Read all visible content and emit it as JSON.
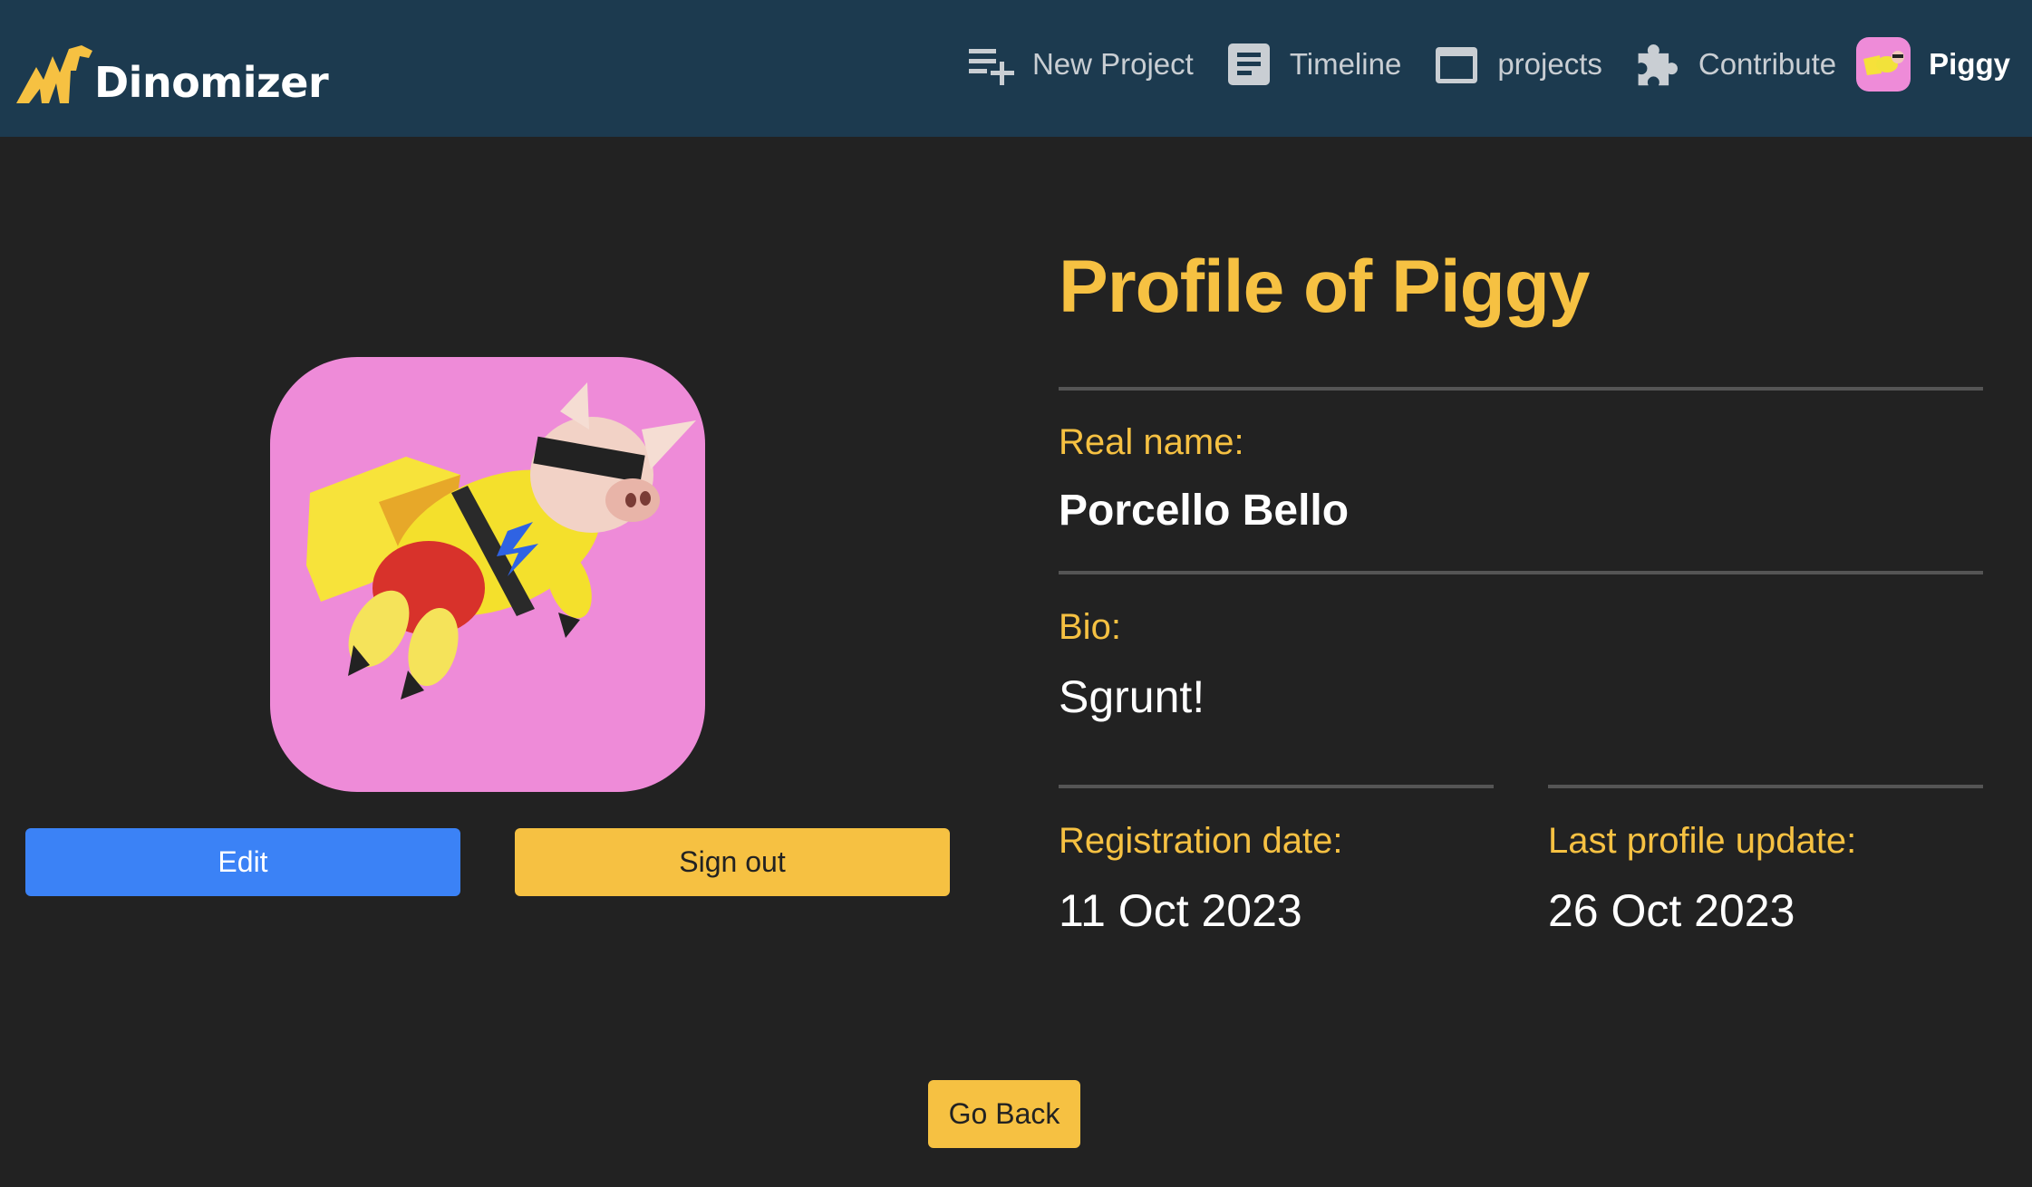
{
  "header": {
    "brand": "Dinomizer",
    "nav": [
      {
        "label": "New Project",
        "icon": "playlist-add-icon"
      },
      {
        "label": "Timeline",
        "icon": "timeline-doc-icon"
      },
      {
        "label": "projects",
        "icon": "window-icon"
      },
      {
        "label": "Contribute",
        "icon": "puzzle-icon"
      }
    ],
    "user": "Piggy"
  },
  "profile": {
    "title": "Profile of Piggy",
    "real_name_label": "Real name:",
    "real_name": "Porcello Bello",
    "bio_label": "Bio:",
    "bio": "Sgrunt!",
    "registration_label": "Registration date:",
    "registration_date": "11 Oct 2023",
    "last_update_label": "Last profile update:",
    "last_update": "26 Oct 2023"
  },
  "actions": {
    "edit": "Edit",
    "sign_out": "Sign out",
    "go_back": "Go Back"
  },
  "colors": {
    "header_bg": "#1c3a4f",
    "page_bg": "#222222",
    "accent": "#f6c142",
    "primary": "#3b82f6",
    "avatar_bg": "#ee8bd8"
  }
}
